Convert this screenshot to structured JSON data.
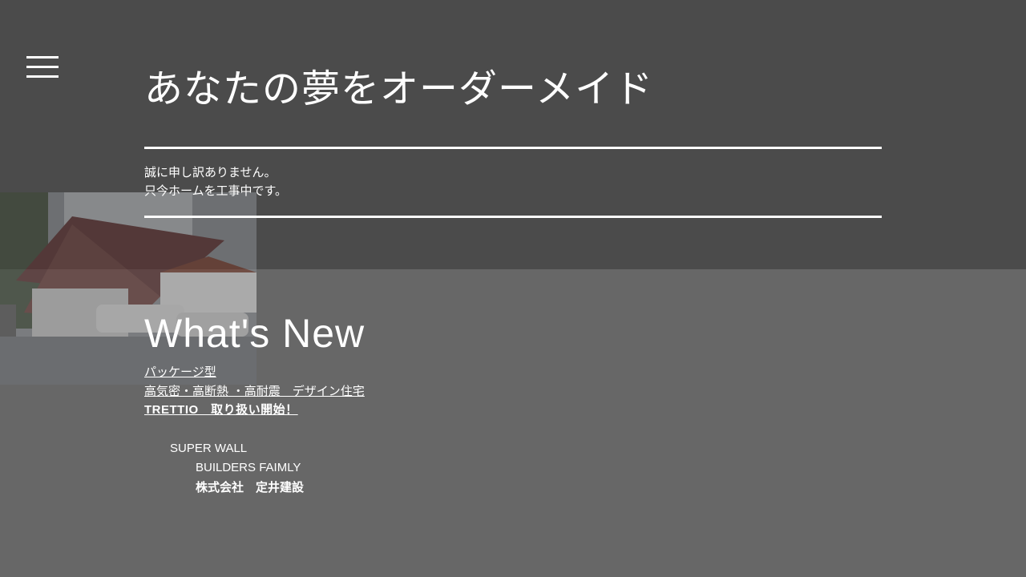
{
  "menu": {
    "icon": "hamburger-menu-icon"
  },
  "hero": {
    "title": "あなたの夢をオーダーメイド",
    "notice_line1": "誠に申し訳ありません。",
    "notice_line2": "只今ホームを工事中です。"
  },
  "news": {
    "heading": "What's New",
    "links": [
      "パッケージ型",
      "高気密・高断熱 ・高耐震　デザイン住宅",
      "TRETTIO　取り扱い開始！"
    ]
  },
  "company": {
    "line1": "SUPER WALL",
    "line2": "BUILDERS FAIMLY",
    "line3": "株式会社　定井建設"
  },
  "colors": {
    "top_band": "#4b4b4b",
    "background": "#676767",
    "text": "#ffffff"
  }
}
